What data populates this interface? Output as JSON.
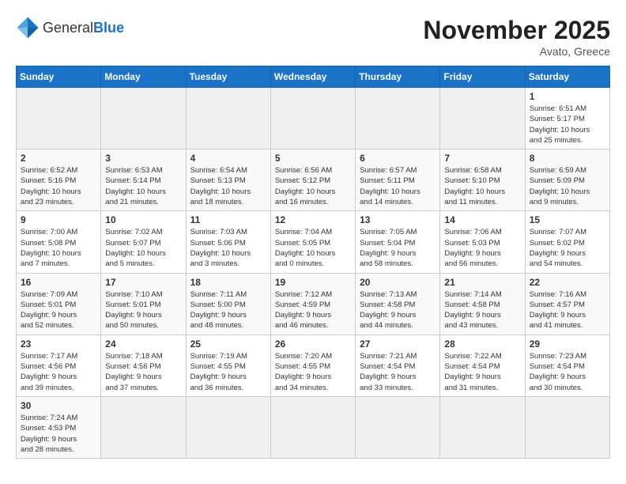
{
  "header": {
    "logo_general": "General",
    "logo_blue": "Blue",
    "month": "November 2025",
    "location": "Avato, Greece"
  },
  "weekdays": [
    "Sunday",
    "Monday",
    "Tuesday",
    "Wednesday",
    "Thursday",
    "Friday",
    "Saturday"
  ],
  "weeks": [
    [
      {
        "day": "",
        "info": ""
      },
      {
        "day": "",
        "info": ""
      },
      {
        "day": "",
        "info": ""
      },
      {
        "day": "",
        "info": ""
      },
      {
        "day": "",
        "info": ""
      },
      {
        "day": "",
        "info": ""
      },
      {
        "day": "1",
        "info": "Sunrise: 6:51 AM\nSunset: 5:17 PM\nDaylight: 10 hours\nand 25 minutes."
      }
    ],
    [
      {
        "day": "2",
        "info": "Sunrise: 6:52 AM\nSunset: 5:16 PM\nDaylight: 10 hours\nand 23 minutes."
      },
      {
        "day": "3",
        "info": "Sunrise: 6:53 AM\nSunset: 5:14 PM\nDaylight: 10 hours\nand 21 minutes."
      },
      {
        "day": "4",
        "info": "Sunrise: 6:54 AM\nSunset: 5:13 PM\nDaylight: 10 hours\nand 18 minutes."
      },
      {
        "day": "5",
        "info": "Sunrise: 6:56 AM\nSunset: 5:12 PM\nDaylight: 10 hours\nand 16 minutes."
      },
      {
        "day": "6",
        "info": "Sunrise: 6:57 AM\nSunset: 5:11 PM\nDaylight: 10 hours\nand 14 minutes."
      },
      {
        "day": "7",
        "info": "Sunrise: 6:58 AM\nSunset: 5:10 PM\nDaylight: 10 hours\nand 11 minutes."
      },
      {
        "day": "8",
        "info": "Sunrise: 6:59 AM\nSunset: 5:09 PM\nDaylight: 10 hours\nand 9 minutes."
      }
    ],
    [
      {
        "day": "9",
        "info": "Sunrise: 7:00 AM\nSunset: 5:08 PM\nDaylight: 10 hours\nand 7 minutes."
      },
      {
        "day": "10",
        "info": "Sunrise: 7:02 AM\nSunset: 5:07 PM\nDaylight: 10 hours\nand 5 minutes."
      },
      {
        "day": "11",
        "info": "Sunrise: 7:03 AM\nSunset: 5:06 PM\nDaylight: 10 hours\nand 3 minutes."
      },
      {
        "day": "12",
        "info": "Sunrise: 7:04 AM\nSunset: 5:05 PM\nDaylight: 10 hours\nand 0 minutes."
      },
      {
        "day": "13",
        "info": "Sunrise: 7:05 AM\nSunset: 5:04 PM\nDaylight: 9 hours\nand 58 minutes."
      },
      {
        "day": "14",
        "info": "Sunrise: 7:06 AM\nSunset: 5:03 PM\nDaylight: 9 hours\nand 56 minutes."
      },
      {
        "day": "15",
        "info": "Sunrise: 7:07 AM\nSunset: 5:02 PM\nDaylight: 9 hours\nand 54 minutes."
      }
    ],
    [
      {
        "day": "16",
        "info": "Sunrise: 7:09 AM\nSunset: 5:01 PM\nDaylight: 9 hours\nand 52 minutes."
      },
      {
        "day": "17",
        "info": "Sunrise: 7:10 AM\nSunset: 5:01 PM\nDaylight: 9 hours\nand 50 minutes."
      },
      {
        "day": "18",
        "info": "Sunrise: 7:11 AM\nSunset: 5:00 PM\nDaylight: 9 hours\nand 48 minutes."
      },
      {
        "day": "19",
        "info": "Sunrise: 7:12 AM\nSunset: 4:59 PM\nDaylight: 9 hours\nand 46 minutes."
      },
      {
        "day": "20",
        "info": "Sunrise: 7:13 AM\nSunset: 4:58 PM\nDaylight: 9 hours\nand 44 minutes."
      },
      {
        "day": "21",
        "info": "Sunrise: 7:14 AM\nSunset: 4:58 PM\nDaylight: 9 hours\nand 43 minutes."
      },
      {
        "day": "22",
        "info": "Sunrise: 7:16 AM\nSunset: 4:57 PM\nDaylight: 9 hours\nand 41 minutes."
      }
    ],
    [
      {
        "day": "23",
        "info": "Sunrise: 7:17 AM\nSunset: 4:56 PM\nDaylight: 9 hours\nand 39 minutes."
      },
      {
        "day": "24",
        "info": "Sunrise: 7:18 AM\nSunset: 4:56 PM\nDaylight: 9 hours\nand 37 minutes."
      },
      {
        "day": "25",
        "info": "Sunrise: 7:19 AM\nSunset: 4:55 PM\nDaylight: 9 hours\nand 36 minutes."
      },
      {
        "day": "26",
        "info": "Sunrise: 7:20 AM\nSunset: 4:55 PM\nDaylight: 9 hours\nand 34 minutes."
      },
      {
        "day": "27",
        "info": "Sunrise: 7:21 AM\nSunset: 4:54 PM\nDaylight: 9 hours\nand 33 minutes."
      },
      {
        "day": "28",
        "info": "Sunrise: 7:22 AM\nSunset: 4:54 PM\nDaylight: 9 hours\nand 31 minutes."
      },
      {
        "day": "29",
        "info": "Sunrise: 7:23 AM\nSunset: 4:54 PM\nDaylight: 9 hours\nand 30 minutes."
      }
    ],
    [
      {
        "day": "30",
        "info": "Sunrise: 7:24 AM\nSunset: 4:53 PM\nDaylight: 9 hours\nand 28 minutes."
      },
      {
        "day": "",
        "info": ""
      },
      {
        "day": "",
        "info": ""
      },
      {
        "day": "",
        "info": ""
      },
      {
        "day": "",
        "info": ""
      },
      {
        "day": "",
        "info": ""
      },
      {
        "day": "",
        "info": ""
      }
    ]
  ]
}
